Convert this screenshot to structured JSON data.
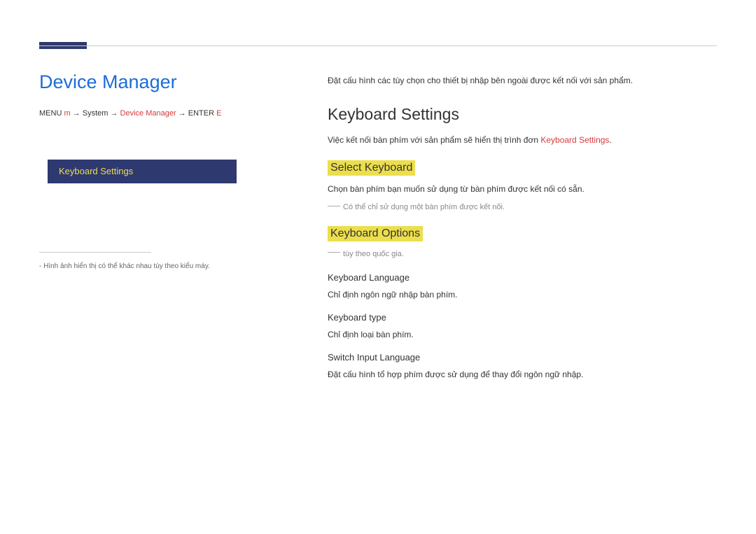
{
  "page": {
    "title": "Device Manager",
    "breadcrumb_menu": "MENU ",
    "breadcrumb_arrow1": "→ ",
    "breadcrumb_m": "m",
    "breadcrumb_system": " → System → ",
    "breadcrumb_dm": "Device Manager",
    "breadcrumb_enter": " → ENTER ",
    "breadcrumb_e": "E",
    "menu_item": "Keyboard Settings",
    "footnote": "- Hình ảnh hiển thị có thể khác nhau tùy theo kiểu máy."
  },
  "right": {
    "intro": "Đặt cấu hình các tùy chọn cho thiết bị nhập bên ngoài được kết nối với sản phẩm.",
    "keyboard_settings": {
      "heading": "Keyboard Settings",
      "desc_prefix": "Việc kết nối bàn phím với sản phẩm sẽ hiển thị trình đơn ",
      "desc_red": "Keyboard Settings",
      "desc_suffix": "."
    },
    "select_keyboard": {
      "heading": "Select Keyboard",
      "desc": "Chọn bàn phím bạn muốn sử dụng từ bàn phím được kết nối có sẵn.",
      "note": "Có thể chỉ sử dụng một bàn phím được kết nối."
    },
    "keyboard_options": {
      "heading": "Keyboard Options",
      "note": "tùy theo quốc gia.",
      "kbd_language": {
        "heading": "Keyboard Language",
        "desc": "Chỉ định ngôn ngữ nhập bàn phím."
      },
      "kbd_type": {
        "heading": "Keyboard type",
        "desc": "Chỉ định loại bàn phím."
      },
      "switch_lang": {
        "heading": "Switch Input Language",
        "desc": "Đặt cấu hình tổ hợp phím được sử dụng để thay đổi ngôn ngữ nhập."
      }
    }
  }
}
